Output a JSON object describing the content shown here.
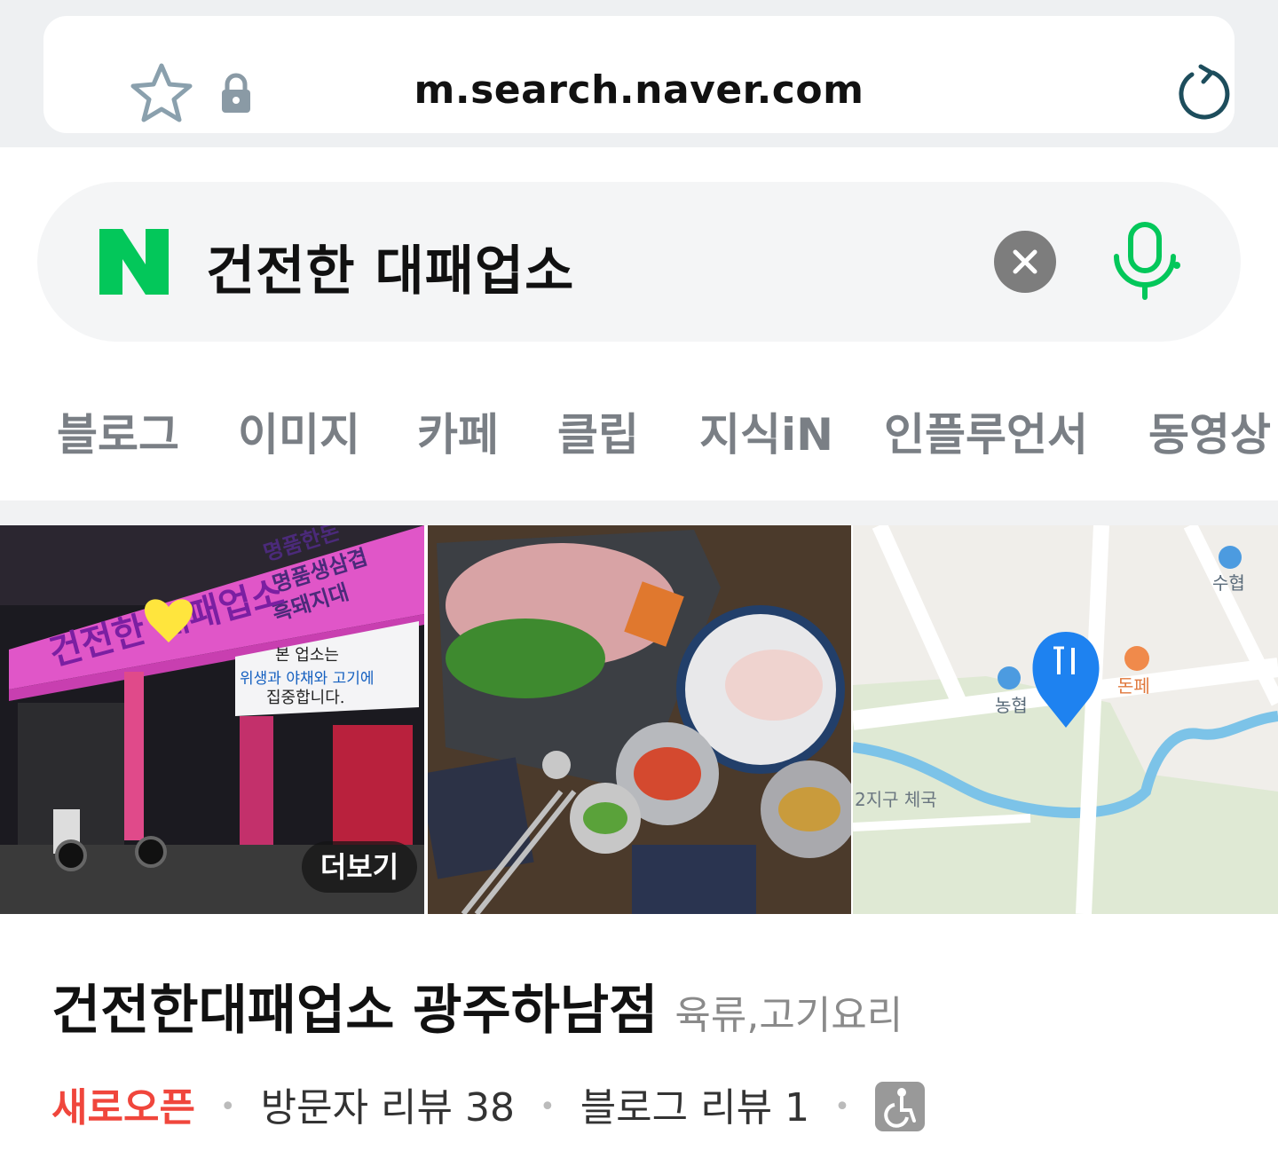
{
  "browser": {
    "url": "m.search.naver.com"
  },
  "search": {
    "logo": "N",
    "query": "건전한 대패업소"
  },
  "tabs": [
    "블로그",
    "이미지",
    "카페",
    "클립",
    "지식iN",
    "인플루언서",
    "동영상"
  ],
  "photos": {
    "more_label": "더보기",
    "sign_lines": [
      "명품한돈",
      "명품생삼겹",
      "흑돼지대"
    ],
    "sign_notice": [
      "본 업소는",
      "위생과 야채와 고기에",
      "집중합니다."
    ],
    "sign_brand": "건전한 대패업소",
    "map_labels": {
      "bank1": "수협",
      "bank2": "농협",
      "restaurant": "돈페",
      "district": "2지구 체국"
    }
  },
  "place": {
    "name": "건전한대패업소 광주하남점",
    "category": "육류,고기요리",
    "status": "새로오픈",
    "visitor_reviews": "방문자 리뷰 38",
    "blog_reviews": "블로그 리뷰 1"
  },
  "icons": {
    "star": "star-icon",
    "lock": "lock-icon",
    "reload": "reload-icon",
    "clear": "clear-icon",
    "mic": "mic-icon",
    "accessibility": "wheelchair-icon"
  },
  "colors": {
    "naver_green": "#03c75a",
    "new_open_red": "#f0463c",
    "map_pin_blue": "#1e82f0"
  }
}
